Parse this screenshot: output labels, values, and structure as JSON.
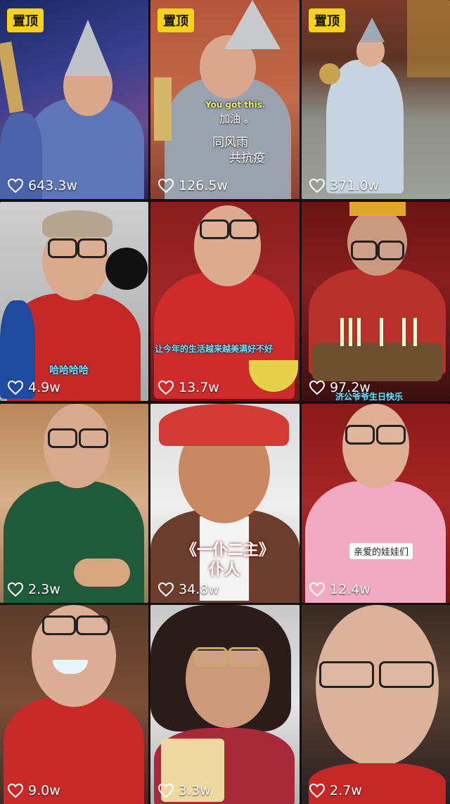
{
  "pin_label": "置顶",
  "tiles": [
    {
      "likes": "643.3w",
      "pinned": true
    },
    {
      "likes": "126.5w",
      "pinned": true,
      "caption_en": "You got this.",
      "caption_1": "加油 。",
      "caption_2": "同风雨",
      "caption_3": "共抗疫"
    },
    {
      "likes": "371.0w",
      "pinned": true
    },
    {
      "likes": "4.9w",
      "caption": "哈哈哈哈"
    },
    {
      "likes": "13.7w",
      "caption": "让今年的生活越来越美满好不好"
    },
    {
      "likes": "97.2w",
      "caption": "济公爷爷生日快乐"
    },
    {
      "likes": "2.3w"
    },
    {
      "likes": "34.8w",
      "caption_1": "《一仆二主》",
      "caption_2": "仆人"
    },
    {
      "likes": "12.4w",
      "caption": "亲爱的娃娃们"
    },
    {
      "likes": "9.0w"
    },
    {
      "likes": "3.3w"
    },
    {
      "likes": "2.7w"
    }
  ],
  "colors": {
    "pin_bg": "#f7d21c",
    "caption_cyan": "#7fd6ff",
    "background": "#111111"
  },
  "icons": {
    "like": "heart-outline-icon"
  }
}
